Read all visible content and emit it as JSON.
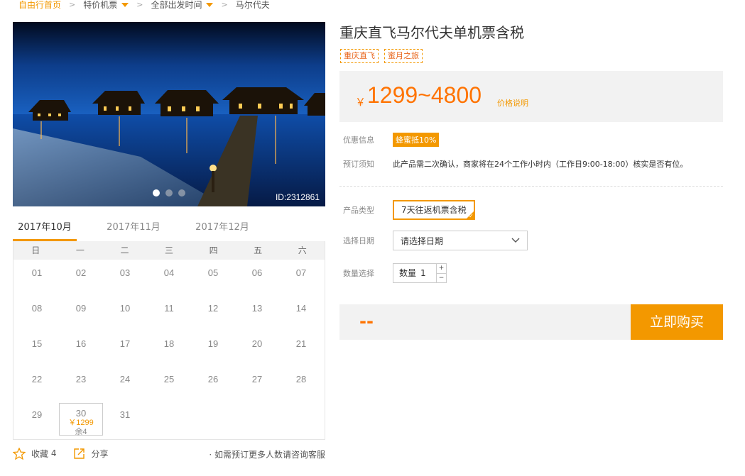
{
  "breadcrumb": {
    "home": "自由行首页",
    "items": [
      "特价机票",
      "全部出发时间",
      "马尔代夫"
    ]
  },
  "hero": {
    "id_label": "ID:2312861",
    "slide_count": 3,
    "active_slide": 1
  },
  "calendar": {
    "months": [
      "2017年10月",
      "2017年11月",
      "2017年12月"
    ],
    "active_month": 0,
    "weekdays": [
      "日",
      "一",
      "二",
      "三",
      "四",
      "五",
      "六"
    ],
    "days": [
      [
        "01",
        "02",
        "03",
        "04",
        "05",
        "06",
        "07"
      ],
      [
        "08",
        "09",
        "10",
        "11",
        "12",
        "13",
        "14"
      ],
      [
        "15",
        "16",
        "17",
        "18",
        "19",
        "20",
        "21"
      ],
      [
        "22",
        "23",
        "24",
        "25",
        "26",
        "27",
        "28"
      ],
      [
        "29",
        "30",
        "31",
        "",
        "",
        "",
        ""
      ]
    ],
    "available": {
      "day": "30",
      "price": "￥1299",
      "stock": "余4"
    }
  },
  "footer": {
    "favorite_label": "收藏",
    "favorite_count": "4",
    "share_label": "分享",
    "note": "· 如需预订更多人数请咨询客服"
  },
  "product": {
    "title": "重庆直飞马尔代夫单机票含税",
    "tags": [
      "重庆直飞",
      "蜜月之旅"
    ],
    "price_currency": "￥",
    "price_range": "1299~4800",
    "price_note": "价格说明",
    "discount_label": "优惠信息",
    "discount_badge": "蜂蜜抵10%",
    "notice_label": "预订须知",
    "notice_text": "此产品需二次确认，商家将在24个工作小时内（工作日9:00-18:00）核实是否有位。"
  },
  "options": {
    "type_label": "产品类型",
    "type_value": "7天往返机票含税",
    "date_label": "选择日期",
    "date_value": "请选择日期",
    "qty_label": "数量选择",
    "qty_prefix": "数量",
    "qty_value": "1"
  },
  "buy": {
    "total": "--",
    "button": "立即购买"
  },
  "colors": {
    "accent": "#f39800",
    "price": "#ff7300"
  }
}
